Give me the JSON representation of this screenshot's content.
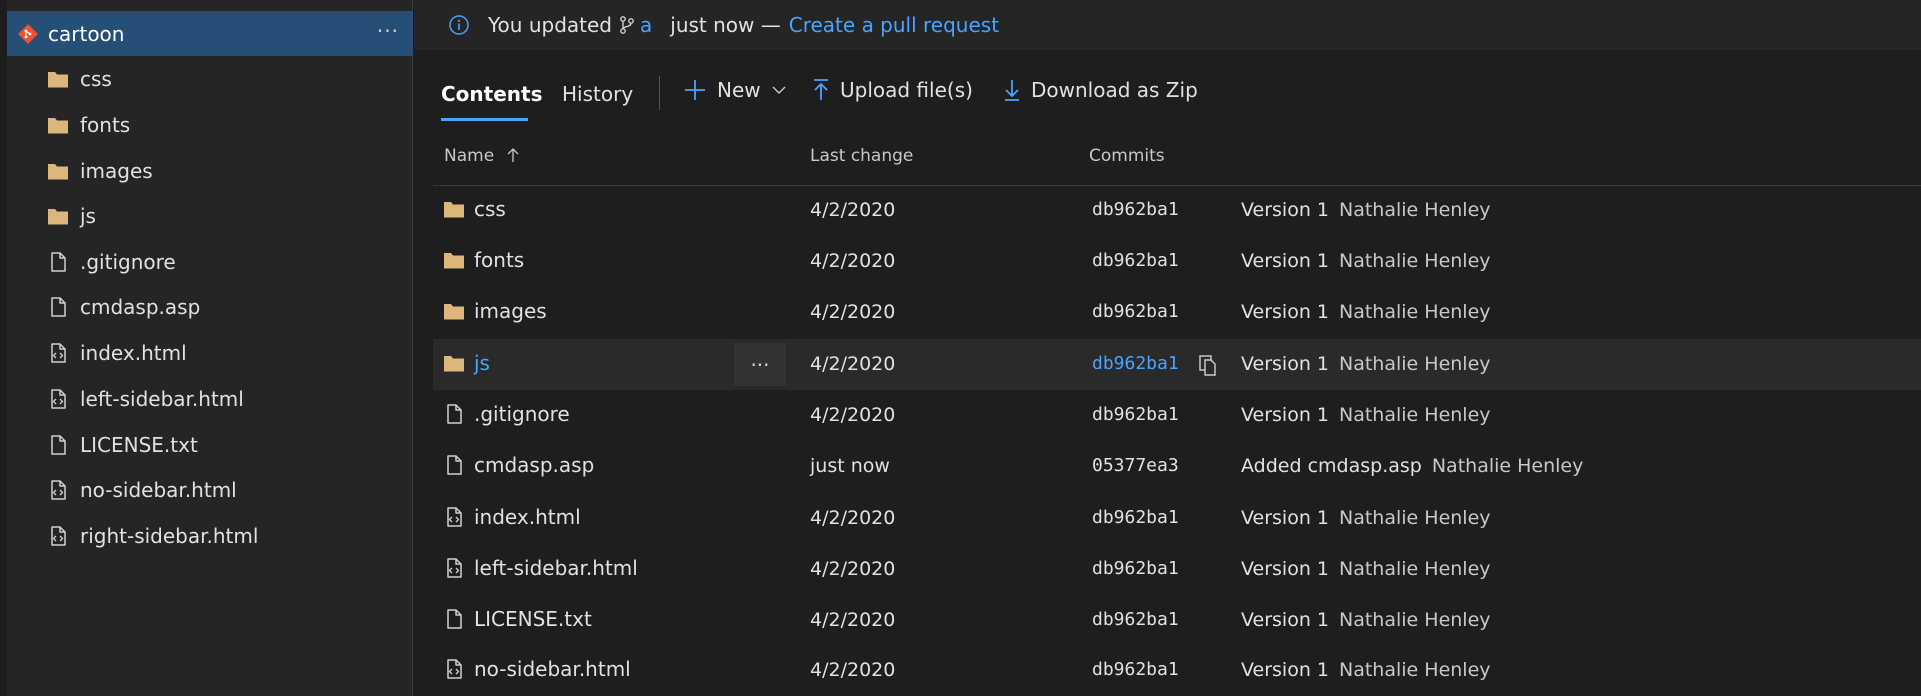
{
  "colors": {
    "accent": "#4aa3ff",
    "selected": "#264f78",
    "folder": "#dcb67a",
    "git": "#f05133"
  },
  "sidebar": {
    "repo_name": "cartoon",
    "items": [
      {
        "label": "css",
        "icon": "folder-icon"
      },
      {
        "label": "fonts",
        "icon": "folder-icon"
      },
      {
        "label": "images",
        "icon": "folder-icon"
      },
      {
        "label": "js",
        "icon": "folder-icon"
      },
      {
        "label": ".gitignore",
        "icon": "file-icon"
      },
      {
        "label": "cmdasp.asp",
        "icon": "file-icon"
      },
      {
        "label": "index.html",
        "icon": "code-file-icon"
      },
      {
        "label": "left-sidebar.html",
        "icon": "code-file-icon"
      },
      {
        "label": "LICENSE.txt",
        "icon": "file-icon"
      },
      {
        "label": "no-sidebar.html",
        "icon": "code-file-icon"
      },
      {
        "label": "right-sidebar.html",
        "icon": "code-file-icon"
      }
    ]
  },
  "banner": {
    "text_before": "You updated",
    "branch": "a",
    "text_after": "just now —",
    "link": "Create a pull request"
  },
  "toolbar": {
    "tab_contents": "Contents",
    "tab_history": "History",
    "new_label": "New",
    "upload_label": "Upload file(s)",
    "download_label": "Download as Zip"
  },
  "table": {
    "headers": {
      "name": "Name",
      "last_change": "Last change",
      "commits": "Commits"
    },
    "rows": [
      {
        "name": "css",
        "icon": "folder-icon",
        "date": "4/2/2020",
        "commit": "db962ba1",
        "message": "Version 1",
        "author": "Nathalie Henley"
      },
      {
        "name": "fonts",
        "icon": "folder-icon",
        "date": "4/2/2020",
        "commit": "db962ba1",
        "message": "Version 1",
        "author": "Nathalie Henley"
      },
      {
        "name": "images",
        "icon": "folder-icon",
        "date": "4/2/2020",
        "commit": "db962ba1",
        "message": "Version 1",
        "author": "Nathalie Henley"
      },
      {
        "name": "js",
        "icon": "folder-icon",
        "date": "4/2/2020",
        "commit": "db962ba1",
        "message": "Version 1",
        "author": "Nathalie Henley"
      },
      {
        "name": ".gitignore",
        "icon": "file-icon",
        "date": "4/2/2020",
        "commit": "db962ba1",
        "message": "Version 1",
        "author": "Nathalie Henley"
      },
      {
        "name": "cmdasp.asp",
        "icon": "file-icon",
        "date": "just now",
        "commit": "05377ea3",
        "message": "Added cmdasp.asp",
        "author": "Nathalie Henley"
      },
      {
        "name": "index.html",
        "icon": "code-file-icon",
        "date": "4/2/2020",
        "commit": "db962ba1",
        "message": "Version 1",
        "author": "Nathalie Henley"
      },
      {
        "name": "left-sidebar.html",
        "icon": "code-file-icon",
        "date": "4/2/2020",
        "commit": "db962ba1",
        "message": "Version 1",
        "author": "Nathalie Henley"
      },
      {
        "name": "LICENSE.txt",
        "icon": "file-icon",
        "date": "4/2/2020",
        "commit": "db962ba1",
        "message": "Version 1",
        "author": "Nathalie Henley"
      },
      {
        "name": "no-sidebar.html",
        "icon": "code-file-icon",
        "date": "4/2/2020",
        "commit": "db962ba1",
        "message": "Version 1",
        "author": "Nathalie Henley"
      }
    ]
  }
}
